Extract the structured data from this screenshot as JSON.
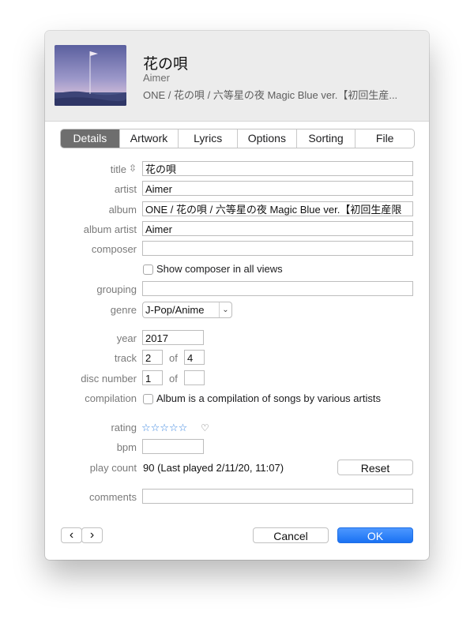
{
  "header": {
    "title": "花の唄",
    "artist": "Aimer",
    "album": "ONE / 花の唄 / 六等星の夜 Magic Blue ver.【初回生産..."
  },
  "tabs": [
    "Details",
    "Artwork",
    "Lyrics",
    "Options",
    "Sorting",
    "File"
  ],
  "active_tab": "Details",
  "labels": {
    "title": "title",
    "artist": "artist",
    "album": "album",
    "album_artist": "album artist",
    "composer": "composer",
    "grouping": "grouping",
    "genre": "genre",
    "year": "year",
    "track": "track",
    "disc_number": "disc number",
    "compilation": "compilation",
    "rating": "rating",
    "bpm": "bpm",
    "play_count": "play count",
    "comments": "comments",
    "of": "of"
  },
  "fields": {
    "title": "花の唄",
    "artist": "Aimer",
    "album": "ONE / 花の唄 / 六等星の夜 Magic Blue ver.【初回生産限",
    "album_artist": "Aimer",
    "composer": "",
    "grouping": "",
    "genre": "J-Pop/Anime",
    "year": "2017",
    "track_number": "2",
    "track_total": "4",
    "disc_number": "1",
    "disc_total": "",
    "bpm": "",
    "comments": ""
  },
  "checkboxes": {
    "show_composer": {
      "label": "Show composer in all views",
      "checked": false
    },
    "compilation": {
      "label": "Album is a compilation of songs by various artists",
      "checked": false
    }
  },
  "rating": {
    "stars": "☆☆☆☆☆",
    "value": 0,
    "max": 5,
    "loved": false,
    "heart": "♡"
  },
  "play_count": "90 (Last played 2/11/20, 11:07)",
  "buttons": {
    "reset": "Reset",
    "cancel": "Cancel",
    "ok": "OK",
    "prev": "‹",
    "next": "›"
  },
  "icons": {
    "sort": "⇳",
    "chevron": "⌄"
  },
  "colors": {
    "accent": "#1a72f3",
    "star": "#3b86e0",
    "active_tab": "#6e6e6e"
  }
}
